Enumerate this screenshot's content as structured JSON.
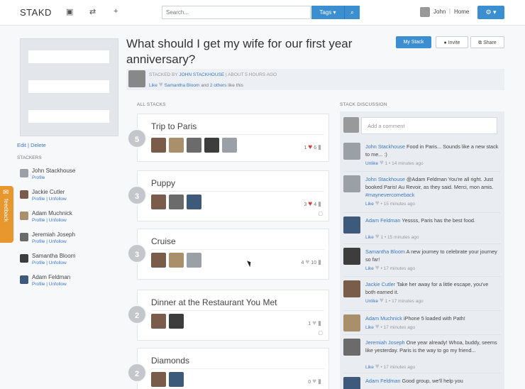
{
  "colors": {
    "accent": "#3b8fd0",
    "link": "#3b78c3",
    "feedback": "#e8962e",
    "heart": "#d83a3a"
  },
  "header": {
    "logo": "STAKD",
    "icons": [
      "bookmark-icon",
      "shuffle-icon",
      "plus-icon"
    ],
    "search_placeholder": "Search...",
    "tags_label": "Tags ▾",
    "search_icon": "⌕",
    "user_name": "John",
    "home_label": "Home",
    "settings_label": "⚙ ▾"
  },
  "sidebar": {
    "edit": "Edit",
    "sep": "|",
    "delete": "Delete",
    "stackers_heading": "STACKERS",
    "stackers": [
      {
        "name": "John Stackhouse",
        "links": "Profile"
      },
      {
        "name": "Jackie Cutler",
        "links": "Profile | Unfollow"
      },
      {
        "name": "Adam Muchnick",
        "links": "Profile | Unfollow"
      },
      {
        "name": "Jeremiah Joseph",
        "links": "Profile | Unfollow"
      },
      {
        "name": "Samantha Bloom",
        "links": "Profile | Unfollow"
      },
      {
        "name": "Adam Feldman",
        "links": "Profile | Unfollow"
      }
    ],
    "feedback_label": "feedback"
  },
  "question": {
    "title": "What should I get my wife for our first year anniversary?",
    "my_stack": "My Stack",
    "invite": "Invite",
    "share": "Share",
    "stacked_by_prefix": "STACKED BY",
    "stacked_by_name": "JOHN STACKHOUSE",
    "stacked_by_time": "| ABOUT 5 HOURS AGO",
    "like_word": "Like",
    "likers_name": "Samantha Bloom",
    "likers_rest": "and",
    "likers_others": "2 others",
    "likers_tail": "like this"
  },
  "stacks_heading": "ALL STACKS",
  "stacks": [
    {
      "rank": "5",
      "title": "Trip to Paris",
      "likes": "1",
      "comments": "6",
      "liked": true,
      "av_colors": [
        "#7a5c4a",
        "#a98f6a",
        "#6b6b6b",
        "#3d3d3d",
        "#9aa0a6"
      ]
    },
    {
      "rank": "3",
      "title": "Puppy",
      "likes": "3",
      "comments": "4",
      "liked": true,
      "av_colors": [
        "#7a5c4a",
        "#6b6b6b",
        "#3d5a7a"
      ]
    },
    {
      "rank": "3",
      "title": "Cruise",
      "likes": "4",
      "comments": "10",
      "liked": false,
      "av_colors": [
        "#7a5c4a",
        "#a98f6a",
        "#9aa0a6"
      ]
    },
    {
      "rank": "2",
      "title": "Dinner at the Restaurant You Met",
      "likes": "1",
      "comments": "",
      "liked": false,
      "av_colors": [
        "#7a5c4a",
        "#3d3d3d"
      ]
    },
    {
      "rank": "2",
      "title": "Diamonds",
      "likes": "0",
      "comments": "",
      "liked": false,
      "av_colors": [
        "#7a5c4a",
        "#3d5a7a"
      ]
    }
  ],
  "discussion": {
    "heading": "STACK DISCUSSION",
    "comment_placeholder": "Add a comment",
    "comments": [
      {
        "author": "John Stackhouse",
        "text": "Food in Paris... Sounds like a new stack to me... :)",
        "tag": "",
        "meta_action": "Unlike",
        "meta_count": "1",
        "meta_time": "14 minutes ago",
        "color": "#9aa0a6"
      },
      {
        "author": "John Stackhouse",
        "text": "@Adam Feldman You're all right. Just booked Paris! Au Revoir, as they said. Merci, mon amis.",
        "tag": "#maynevercomeback",
        "meta_action": "Like",
        "meta_count": "",
        "meta_time": "15 minutes ago",
        "color": "#9aa0a6"
      },
      {
        "author": "Adam Feldman",
        "text": "Yessss, Paris has the best food.",
        "tag": "",
        "meta_action": "Like",
        "meta_count": "1",
        "meta_time": "15 minutes ago",
        "color": "#3d5a7a"
      },
      {
        "author": "Samantha Bloom",
        "text": "A new journey to celebrate your journey so far!",
        "tag": "",
        "meta_action": "Like",
        "meta_count": "",
        "meta_time": "17 minutes ago",
        "color": "#3d3d3d"
      },
      {
        "author": "Jackie Cutler",
        "text": "Take her away for a little escape, you've both earned it.",
        "tag": "",
        "meta_action": "Unlike",
        "meta_count": "1",
        "meta_time": "17 minutes ago",
        "color": "#7a5c4a"
      },
      {
        "author": "Adam Muchnick",
        "text": "iPhone 5 loaded with Path!",
        "tag": "",
        "meta_action": "Like",
        "meta_count": "",
        "meta_time": "17 minutes ago",
        "color": "#a98f6a"
      },
      {
        "author": "Jeremiah Joseph",
        "text": "One year already! Whoa, buddy, seems like yesterday. Paris is the way to go my friend...",
        "tag": "",
        "meta_action": "Like",
        "meta_count": "",
        "meta_time": "17 minutes ago",
        "color": "#6b6b6b"
      },
      {
        "author": "Adam Feldman",
        "text": "Good group, we'll help you",
        "tag": "",
        "meta_action": "",
        "meta_count": "",
        "meta_time": "",
        "color": "#3d5a7a"
      }
    ]
  }
}
